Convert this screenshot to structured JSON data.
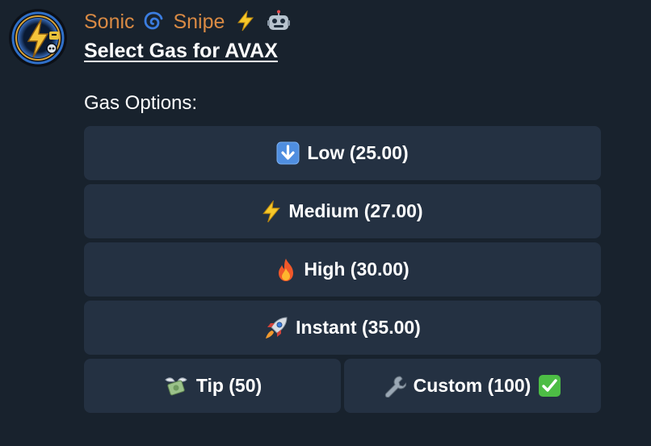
{
  "message": {
    "sender_name": "Sonic",
    "sender_name_2": "Snipe",
    "heading": "Select Gas for AVAX",
    "section_label": "Gas Options:"
  },
  "buttons": [
    {
      "label": "Low (25.00)",
      "icon": "down-arrow-icon"
    },
    {
      "label": "Medium (27.00)",
      "icon": "lightning-icon"
    },
    {
      "label": "High (30.00)",
      "icon": "fire-icon"
    },
    {
      "label": "Instant (35.00)",
      "icon": "rocket-icon"
    },
    {
      "label": "Tip (50)",
      "icon": "money-wings-icon"
    },
    {
      "label": "Custom (100)",
      "icon": "wrench-icon",
      "selected": true
    }
  ],
  "colors": {
    "background": "#18222d",
    "button": "#243142",
    "sender_name": "#d98a44",
    "selected_check": "#4dbd45"
  }
}
